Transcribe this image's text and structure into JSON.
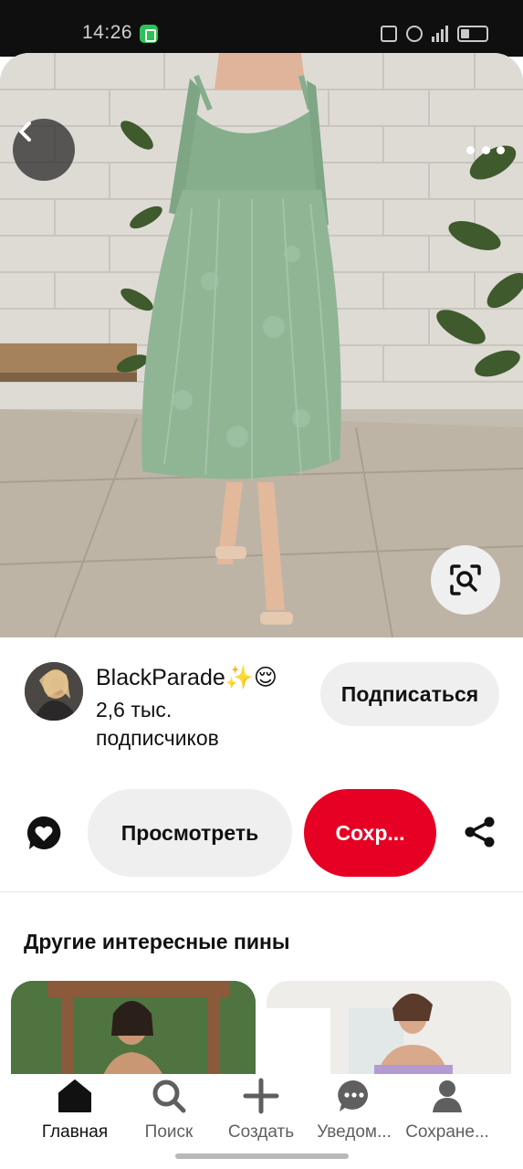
{
  "status_bar": {
    "time": "14:26",
    "icons": [
      "app-notification-icon",
      "nfc-icon",
      "alarm-icon",
      "signal-icon",
      "battery-icon"
    ]
  },
  "pin": {
    "image_description": "green-lace-midi-dress-photo",
    "back_icon": "chevron-left-icon",
    "more_icon": "more-horizontal-icon",
    "visual_search_icon": "lens-search-icon"
  },
  "creator": {
    "name": "BlackParade✨😌",
    "followers_line1": "2,6 тыс.",
    "followers_line2": "подписчиков",
    "follow_label": "Подписаться"
  },
  "actions": {
    "comment_icon": "comment-heart-icon",
    "view_label": "Просмотреть",
    "save_label": "Сохр...",
    "share_icon": "share-icon"
  },
  "more_pins": {
    "title": "Другие интересные пины"
  },
  "bottom_nav": {
    "items": [
      {
        "label": "Главная",
        "icon": "home-icon",
        "active": true
      },
      {
        "label": "Поиск",
        "icon": "search-icon",
        "active": false
      },
      {
        "label": "Создать",
        "icon": "plus-icon",
        "active": false
      },
      {
        "label": "Уведом...",
        "icon": "notifications-icon",
        "active": false
      },
      {
        "label": "Сохране...",
        "icon": "profile-icon",
        "active": false
      }
    ]
  },
  "colors": {
    "accent_red": "#e60023",
    "button_gray": "#efefef",
    "dress_green": "#8fb595"
  }
}
